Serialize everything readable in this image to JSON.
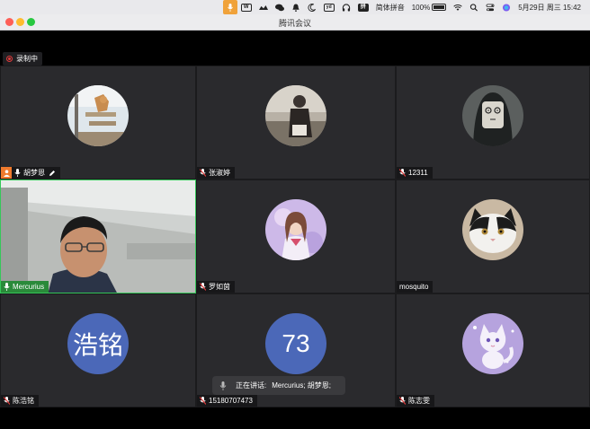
{
  "menubar": {
    "input_method": "简体拼音",
    "battery": "100%",
    "datetime": "5月29日 周三  15:42",
    "yd_label": "yd",
    "pinyin_box": "拼"
  },
  "window": {
    "title": "腾讯会议"
  },
  "recording": {
    "label": "录制中"
  },
  "participants": [
    {
      "name": "胡梦恩",
      "avatar": "photo-cat-window",
      "host": true,
      "muted": false
    },
    {
      "name": "张淑婷",
      "avatar": "photo-person",
      "host": false,
      "muted": true
    },
    {
      "name": "12311",
      "avatar": "photo-mask-face",
      "host": false,
      "muted": true
    },
    {
      "name": "Mercurius",
      "avatar": "camera-video",
      "host": false,
      "muted": false,
      "active_speaker": true
    },
    {
      "name": "罗如茵",
      "avatar": "photo-anime-girl",
      "host": false,
      "muted": true
    },
    {
      "name": "mosquito",
      "avatar": "photo-cat-face",
      "host": false,
      "muted": false
    },
    {
      "name": "陈浩铭",
      "avatar_text": "浩铭",
      "host": false,
      "muted": true
    },
    {
      "name": "15180707473",
      "avatar_text": "73",
      "host": false,
      "muted": true
    },
    {
      "name": "陈志雯",
      "avatar": "photo-white-cat-illustration",
      "host": false,
      "muted": true
    }
  ],
  "speaking": {
    "label": "正在讲话:",
    "names": "Mercurius; 胡梦恩;"
  },
  "colors": {
    "active_border": "#35c759",
    "host_badge": "#ef7a2d",
    "text_avatar": "#4b68b8",
    "record_dot": "#e23b3b"
  }
}
